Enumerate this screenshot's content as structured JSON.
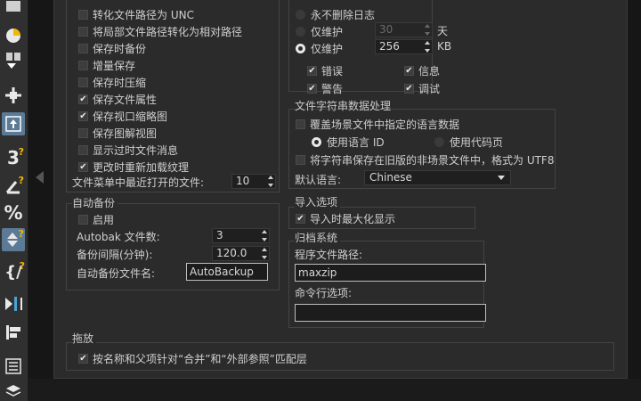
{
  "left_options": [
    {
      "label": "转化文件路径为 UNC",
      "checked": false
    },
    {
      "label": "将局部文件路径转化为相对路径",
      "checked": false
    },
    {
      "label": "保存时备份",
      "checked": false
    },
    {
      "label": "增量保存",
      "checked": false
    },
    {
      "label": "保存时压缩",
      "checked": false
    },
    {
      "label": "保存文件属性",
      "checked": true
    },
    {
      "label": "保存视口缩略图",
      "checked": true
    },
    {
      "label": "保存图解视图",
      "checked": false
    },
    {
      "label": "显示过时文件消息",
      "checked": false
    },
    {
      "label": "更改时重新加载纹理",
      "checked": true
    }
  ],
  "recent_files": {
    "label": "文件菜单中最近打开的文件:",
    "value": "10"
  },
  "autobackup": {
    "title": "自动备份",
    "enable_label": "启用",
    "enable_checked": false,
    "count_label": "Autobak 文件数:",
    "count_value": "3",
    "interval_label": "备份间隔(分钟):",
    "interval_value": "120.0",
    "name_label": "自动备份文件名:",
    "name_value": "AutoBackup"
  },
  "log": {
    "never_delete": "永不删除日志",
    "keep_days_label": "仅维护",
    "keep_days_value": "30",
    "days_unit": "天",
    "keep_kb_label": "仅维护",
    "keep_kb_value": "256",
    "kb_unit": "KB",
    "types": [
      {
        "label": "错误",
        "checked": true
      },
      {
        "label": "信息",
        "checked": true
      },
      {
        "label": "警告",
        "checked": true
      },
      {
        "label": "调试",
        "checked": true
      }
    ]
  },
  "string_handling": {
    "title": "文件字符串数据处理",
    "override_label": "覆盖场景文件中指定的语言数据",
    "use_language_id": "使用语言 ID",
    "use_codepage": "使用代码页",
    "save_utf8": "将字符串保存在旧版的非场景文件中，格式为 UTF8",
    "default_lang_label": "默认语言:",
    "default_lang_value": "Chinese"
  },
  "import": {
    "title": "导入选项",
    "maximize_label": "导入时最大化显示",
    "maximize_checked": true
  },
  "archive": {
    "title": "归档系统",
    "program_label": "程序文件路径:",
    "program_value": "maxzip",
    "cmdline_label": "命令行选项:",
    "cmdline_value": ""
  },
  "dragdrop": {
    "title": "拖放",
    "match_label": "按名称和父项针对“合并”和“外部参照”匹配层",
    "match_checked": true
  },
  "toolbar_icons": [
    "sphere-icon",
    "move-down-icon",
    "move-axis-icon",
    "select-icon",
    "measure-icon",
    "angle-snap-icon",
    "percent-snap-icon",
    "spinner-snap-icon",
    "named-selection-icon",
    "mirror-icon",
    "align-icon",
    "layer-list-icon",
    "stack-icon"
  ]
}
